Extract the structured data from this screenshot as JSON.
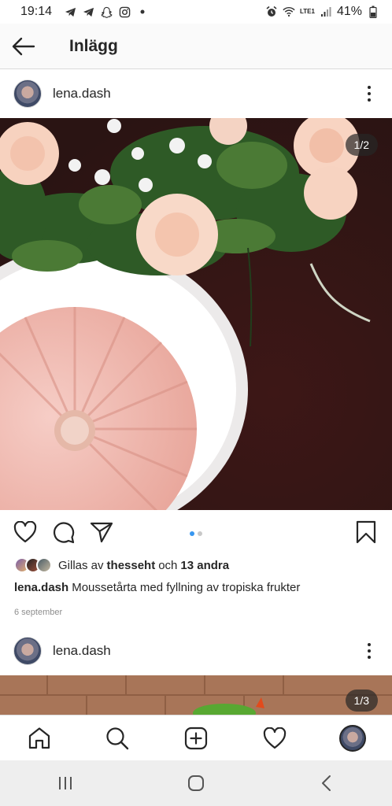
{
  "status_bar": {
    "time": "19:14",
    "battery": "41%",
    "network": "LTE1",
    "left_icons": [
      "telegram-icon",
      "telegram-icon",
      "snapchat-icon",
      "instagram-icon",
      "dot-icon"
    ],
    "right_icons": [
      "alarm-icon",
      "wifi-icon",
      "signal-icon",
      "battery-icon"
    ]
  },
  "header": {
    "title": "Inlägg",
    "back_icon": "arrow-left-icon"
  },
  "posts": [
    {
      "username": "lena.dash",
      "image_counter": "1/2",
      "carousel": {
        "total": 2,
        "active": 1
      },
      "liked_by": "thesseht",
      "likes_prefix": "Gillas av",
      "likes_middle": "och",
      "likes_others": "13 andra",
      "caption": "Moussetårta med fyllning av tropiska frukter",
      "date": "6 september"
    },
    {
      "username": "lena.dash",
      "image_counter": "1/3"
    }
  ],
  "action_icons": [
    "heart-icon",
    "comment-icon",
    "share-icon",
    "bookmark-icon"
  ],
  "bottom_nav": [
    "home-icon",
    "search-icon",
    "add-post-icon",
    "activity-heart-icon",
    "profile-avatar"
  ],
  "system_nav": [
    "recent-apps-icon",
    "home-circle-icon",
    "back-chevron-icon"
  ],
  "colors": {
    "accent": "#3897f0",
    "text": "#262626",
    "secondary_text": "#8e8e8e",
    "background": "#fafafa",
    "cake": "#f0b7ae",
    "image_background": "#3b1d1c"
  }
}
